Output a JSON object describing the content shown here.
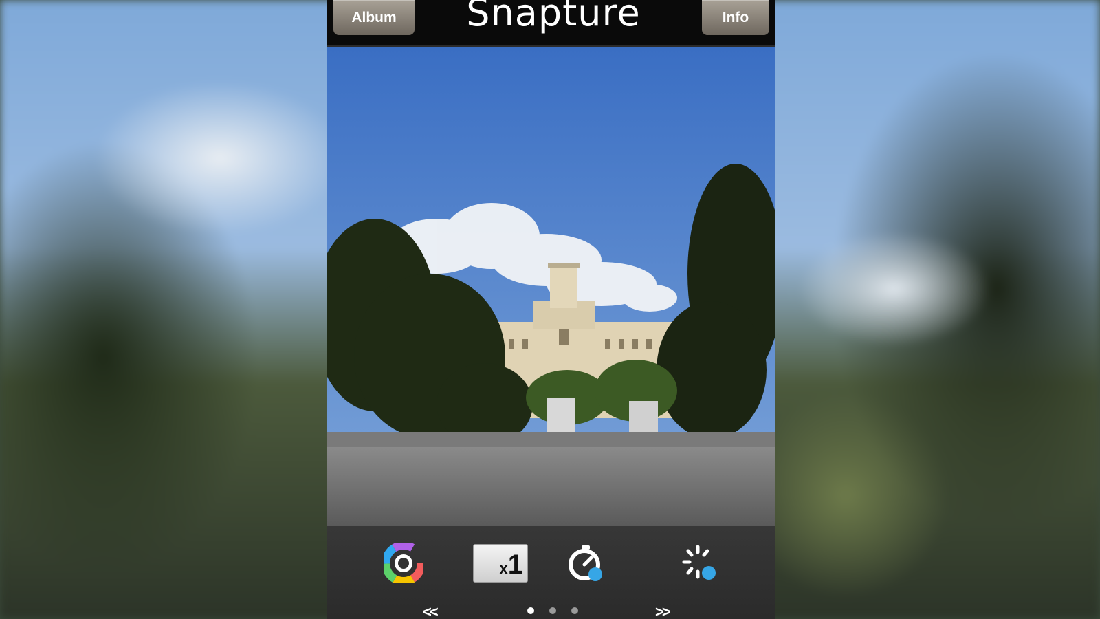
{
  "app": {
    "logo_text": "Snapture",
    "album_label": "Album",
    "info_label": "Info"
  },
  "controls": {
    "filter_icon": "color-wheel-icon",
    "zoom_prefix": "x",
    "zoom_value": "1",
    "timer_icon": "self-timer-icon",
    "burst_icon": "burst-mode-icon"
  },
  "pager": {
    "prev": "<<",
    "next": ">>",
    "page_count": 3,
    "active_page": 1
  },
  "colors": {
    "topbar": "#0a0a0a",
    "button": "#8a8379",
    "controls_bar": "#3c3c3c",
    "timer_accent": "#36a6e6"
  }
}
